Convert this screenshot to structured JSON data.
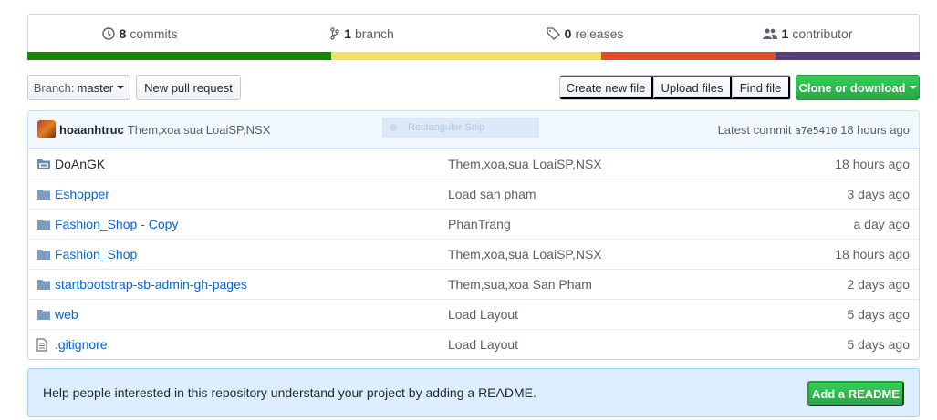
{
  "summary": {
    "commits_count": "8",
    "commits_label": "commits",
    "branches_count": "1",
    "branches_label": "branch",
    "releases_count": "0",
    "releases_label": "releases",
    "contributors_count": "1",
    "contributors_label": "contributor"
  },
  "language_bar": {
    "segments": [
      {
        "color": "#178600",
        "fraction": 0.341
      },
      {
        "color": "#f1e05a",
        "fraction": 0.302
      },
      {
        "color": "#e34c26",
        "fraction": 0.195
      },
      {
        "color": "#563d7c",
        "fraction": 0.162
      }
    ]
  },
  "toolbar": {
    "branch_prefix": "Branch:",
    "branch_name": "master",
    "new_pr": "New pull request",
    "create_file": "Create new file",
    "upload_files": "Upload files",
    "find_file": "Find file",
    "clone": "Clone or download"
  },
  "commit": {
    "author": "hoaanhtruc",
    "message": "Them,xoa,sua LoaiSP,NSX",
    "snip_label": "Rectangular Snip",
    "latest_prefix": "Latest commit",
    "sha": "a7e5410",
    "age": "18 hours ago"
  },
  "files": [
    {
      "name": "DoAnGK",
      "type": "submodule",
      "message": "Them,xoa,sua LoaiSP,NSX",
      "age": "18 hours ago"
    },
    {
      "name": "Eshopper",
      "type": "folder",
      "message": "Load san pham",
      "age": "3 days ago"
    },
    {
      "name": "Fashion_Shop - Copy",
      "type": "folder",
      "message": "PhanTrang",
      "age": "a day ago"
    },
    {
      "name": "Fashion_Shop",
      "type": "folder",
      "message": "Them,xoa,sua LoaiSP,NSX",
      "age": "18 hours ago"
    },
    {
      "name": "startbootstrap-sb-admin-gh-pages",
      "type": "folder",
      "message": "Them,sua,xoa San Pham",
      "age": "2 days ago"
    },
    {
      "name": "web",
      "type": "folder",
      "message": "Load Layout",
      "age": "5 days ago"
    },
    {
      "name": ".gitignore",
      "type": "file",
      "message": "Load Layout",
      "age": "5 days ago"
    }
  ],
  "readme": {
    "text": "Help people interested in this repository understand your project by adding a README.",
    "button": "Add a README"
  }
}
